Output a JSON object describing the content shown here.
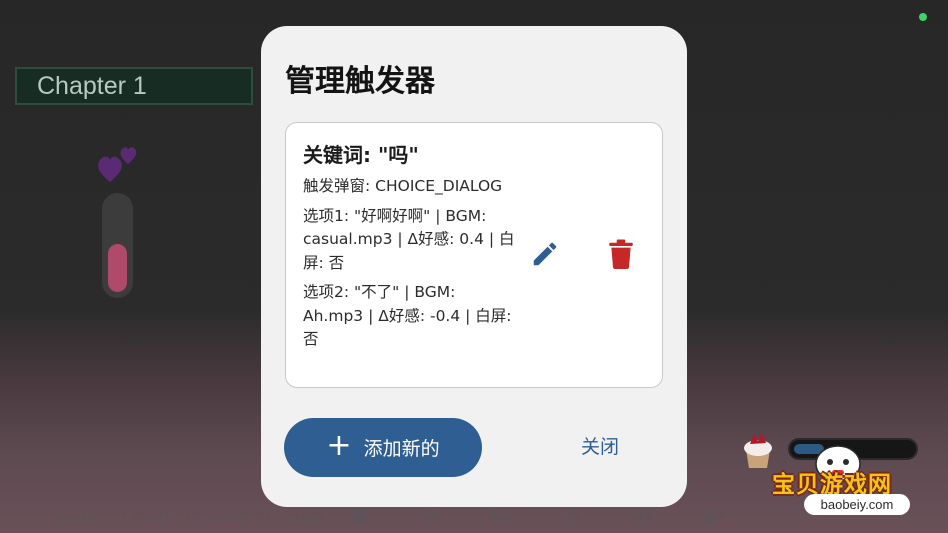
{
  "background": {
    "chapter_label": "Chapter 1",
    "quick_menu": {
      "save": "SAVE",
      "load": "LOAD",
      "qsave": "Q.SAVE",
      "qload": "Q.LOAD",
      "icons": [
        "gear-icon",
        "play-icon",
        "skip-icon",
        "microphone-icon",
        "volume-icon",
        "exit-icon"
      ]
    },
    "watermark": {
      "title": "宝贝游戏网",
      "url": "baobeiy.com"
    },
    "colors": {
      "status_dot": "#3ed46a",
      "meter_fill": "#b04a6a",
      "heart": "#5b2a74"
    }
  },
  "dialog": {
    "title": "管理触发器",
    "trigger": {
      "keyword_line": "关键词: \"吗\"",
      "popup_line": "触发弹窗: CHOICE_DIALOG",
      "option1": "选项1: \"好啊好啊\" | BGM: casual.mp3 | Δ好感: 0.4 | 白屏: 否",
      "option2": "选项2: \"不了\" | BGM: Ah.mp3 | Δ好感: -0.4 | 白屏: 否",
      "edit_icon": "pencil-icon",
      "delete_icon": "trash-icon"
    },
    "add_button": {
      "icon": "+",
      "label": "添加新的"
    },
    "close_button": "关闭",
    "colors": {
      "primary": "#2f5f92",
      "delete": "#c62828",
      "surface": "#f1f1f2"
    }
  }
}
